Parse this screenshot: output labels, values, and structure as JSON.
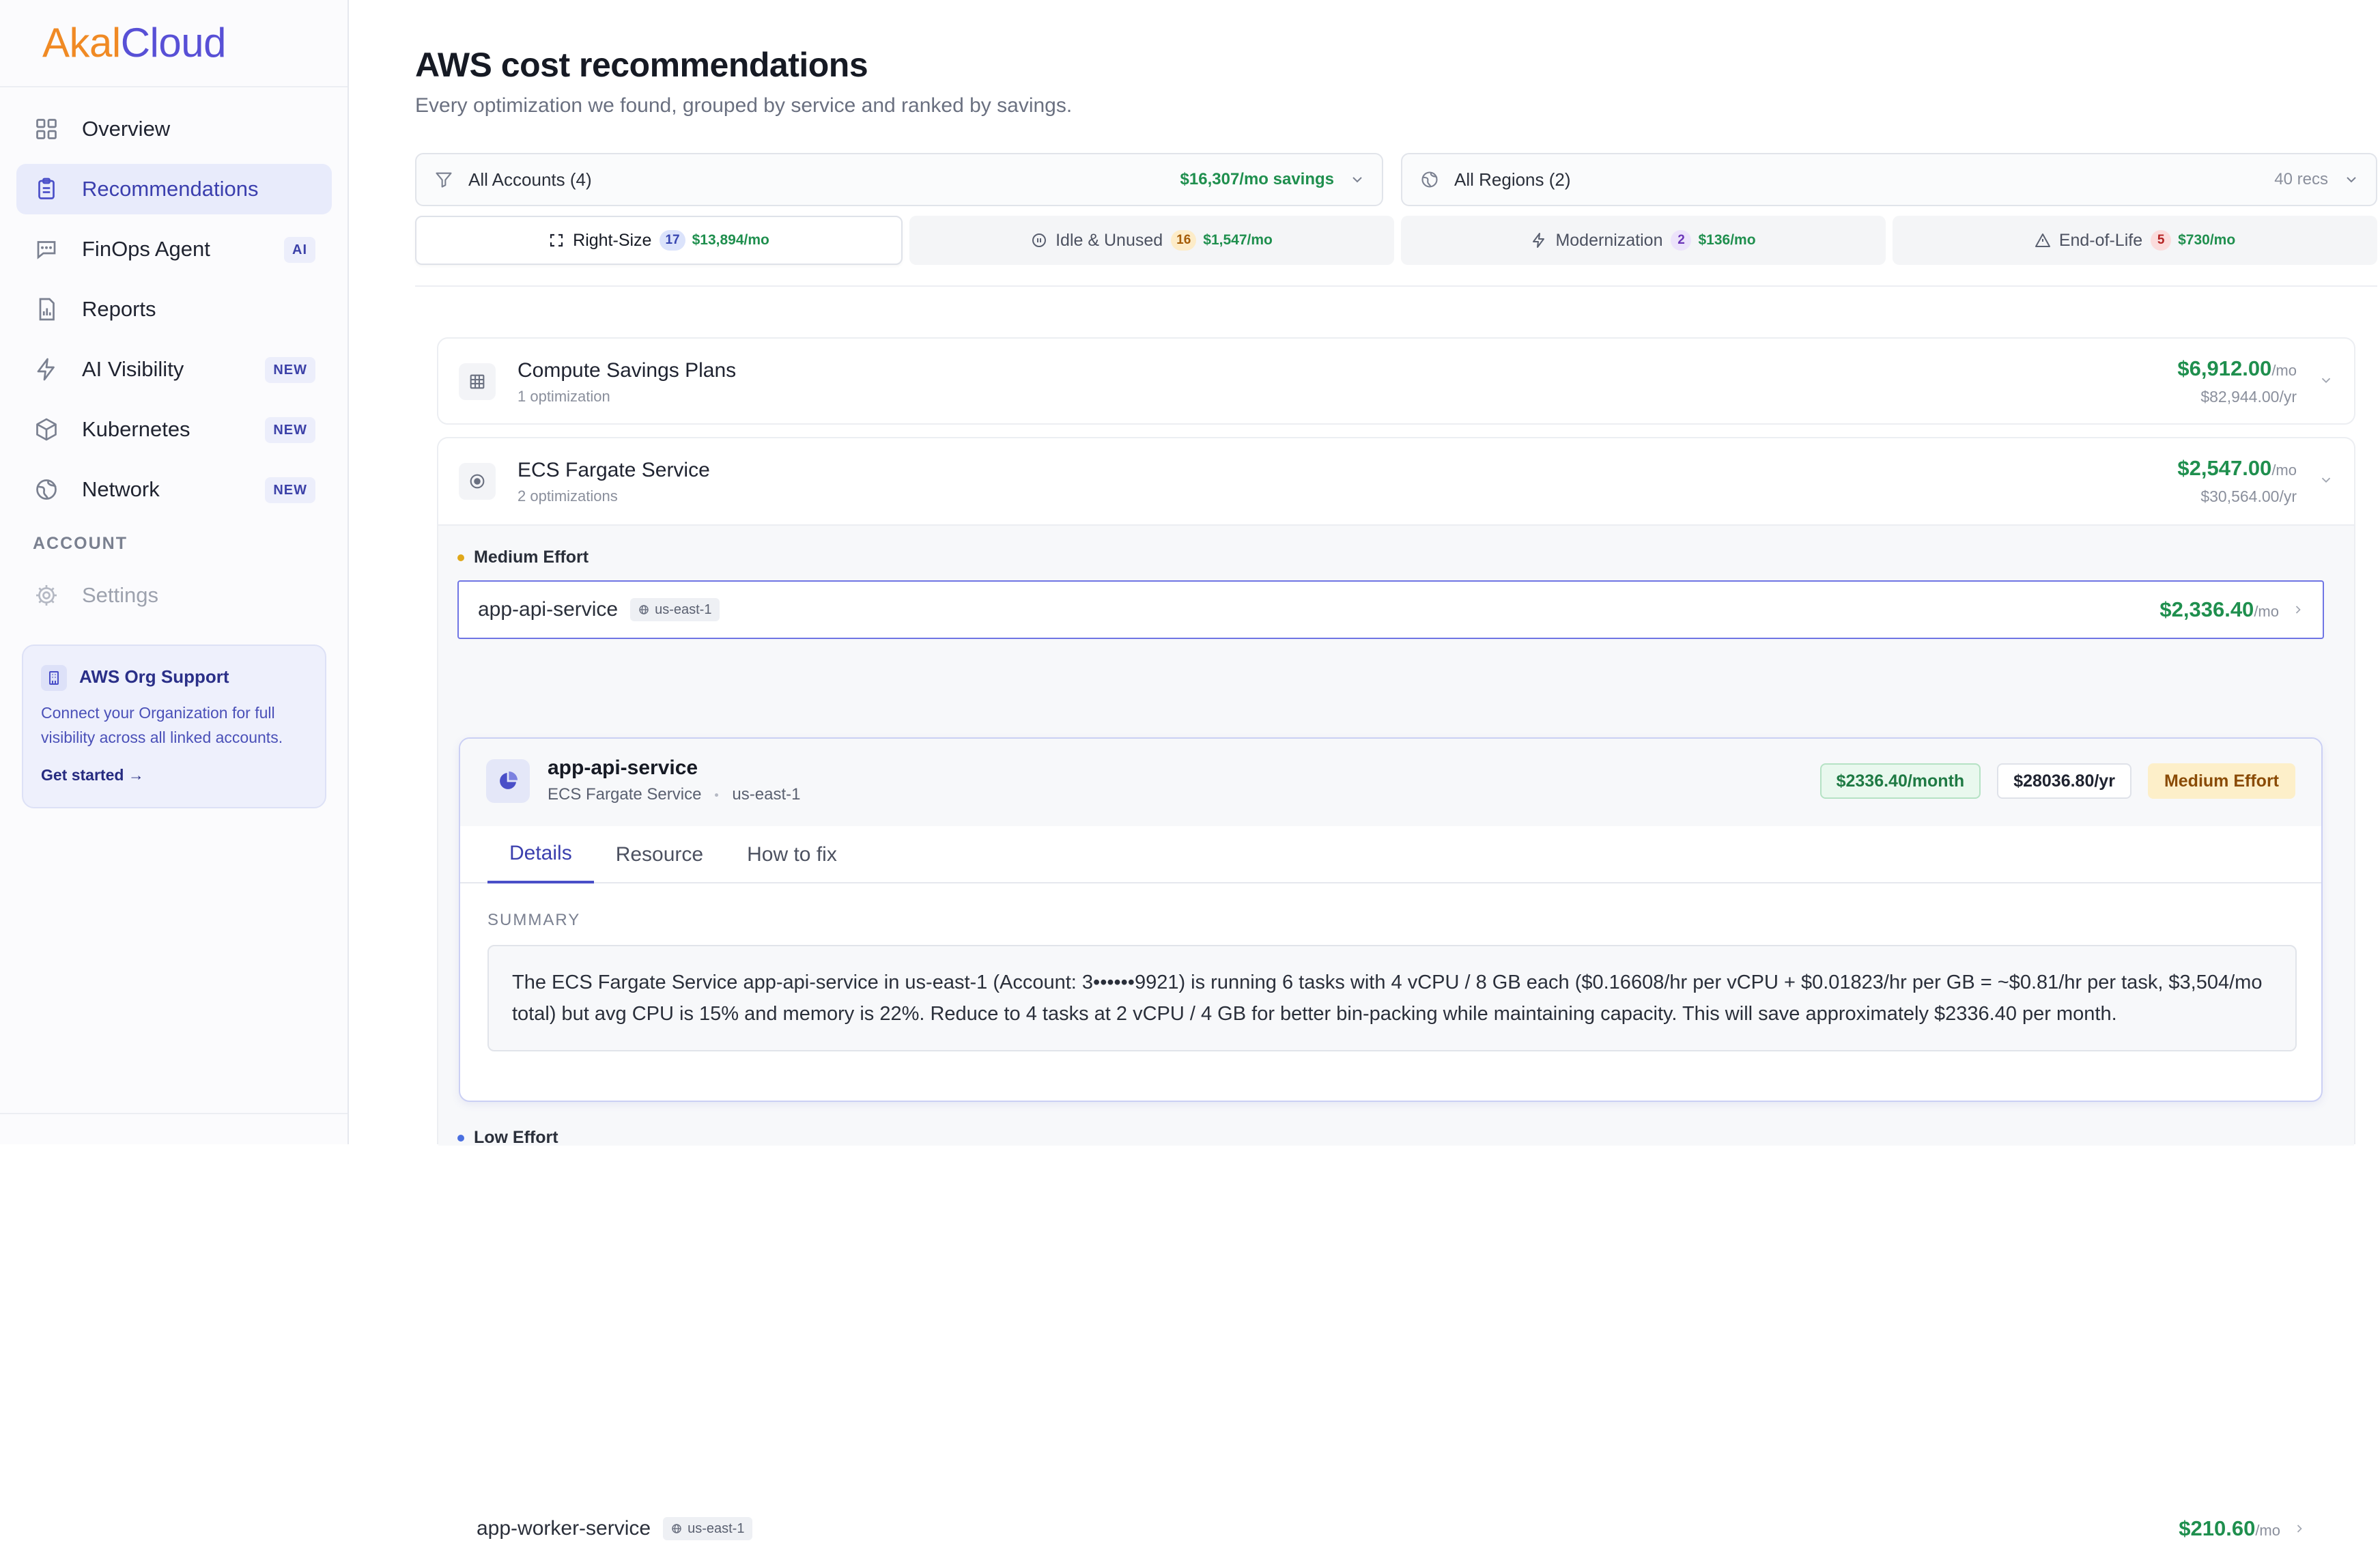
{
  "brand": {
    "part1": "Akal",
    "part2": "Cloud",
    "accent": "#5850d6",
    "accent2": "#f08a24"
  },
  "sidebar": {
    "items": [
      {
        "label": "Overview",
        "icon": "grid-icon",
        "badge": ""
      },
      {
        "label": "Recommendations",
        "icon": "clipboard-icon",
        "badge": "",
        "active": true
      },
      {
        "label": "FinOps Agent",
        "icon": "chat-icon",
        "badge": "AI"
      },
      {
        "label": "Reports",
        "icon": "report-icon",
        "badge": ""
      },
      {
        "label": "AI Visibility",
        "icon": "bolt-icon",
        "badge": "NEW"
      },
      {
        "label": "Kubernetes",
        "icon": "cube-icon",
        "badge": "NEW"
      },
      {
        "label": "Network",
        "icon": "globe-icon",
        "badge": "NEW"
      }
    ],
    "section_label": "ACCOUNT",
    "settings_label": "Settings",
    "org_card": {
      "title": "AWS Org Support",
      "text": "Connect your Organization for full visibility across all linked accounts.",
      "link": "Get started",
      "link_arrow": "→"
    }
  },
  "header": {
    "title": "AWS cost recommendations",
    "subtitle": "Every optimization we found, grouped by service and ranked by savings."
  },
  "filters": {
    "accounts": {
      "label": "All Accounts (4)",
      "savings": "$16,307/mo savings"
    },
    "regions": {
      "label": "All Regions (2)",
      "count": "40 recs"
    }
  },
  "categories": [
    {
      "label": "Right-Size",
      "count": "17",
      "amount": "$13,894/mo",
      "icon": "resize-icon",
      "color": "blue",
      "active": true
    },
    {
      "label": "Idle & Unused",
      "count": "16",
      "amount": "$1,547/mo",
      "icon": "pause-icon",
      "color": "amber"
    },
    {
      "label": "Modernization",
      "count": "2",
      "amount": "$136/mo",
      "icon": "bolt-icon",
      "color": "violet"
    },
    {
      "label": "End-of-Life",
      "count": "5",
      "amount": "$730/mo",
      "icon": "warning-icon",
      "color": "red"
    }
  ],
  "groups": [
    {
      "title": "Compute Savings Plans",
      "subtitle": "1 optimization",
      "monthly": "$6,912.00",
      "unit": "/mo",
      "yearly": "$82,944.00/yr",
      "icon": "table-icon"
    },
    {
      "title": "ECS Fargate Service",
      "subtitle": "2 optimizations",
      "monthly": "$2,547.00",
      "unit": "/mo",
      "yearly": "$30,564.00/yr",
      "icon": "target-icon"
    }
  ],
  "efforts": {
    "medium": "Medium Effort",
    "low": "Low Effort"
  },
  "recs": [
    {
      "name": "app-api-service",
      "region": "us-east-1",
      "amount": "$2,336.40",
      "unit": "/mo"
    },
    {
      "name": "app-worker-service",
      "region": "us-east-1",
      "amount": "$210.60",
      "unit": "/mo"
    }
  ],
  "detail": {
    "title": "app-api-service",
    "service": "ECS Fargate Service",
    "region": "us-east-1",
    "monthly_pill": "$2336.40/month",
    "yearly_pill": "$28036.80/yr",
    "effort_pill": "Medium Effort",
    "tabs": [
      "Details",
      "Resource",
      "How to fix"
    ],
    "summary_label": "SUMMARY",
    "summary": "The ECS Fargate Service app-api-service in us-east-1 (Account: 3••••••9921) is running 6 tasks with 4 vCPU / 8 GB each ($0.16608/hr per vCPU + $0.01823/hr per GB = ~$0.81/hr per task, $3,504/mo total) but avg CPU is 15% and memory is 22%. Reduce to 4 tasks at 2 vCPU / 4 GB for better bin-packing while maintaining capacity. This will save approximately $2336.40 per month."
  }
}
